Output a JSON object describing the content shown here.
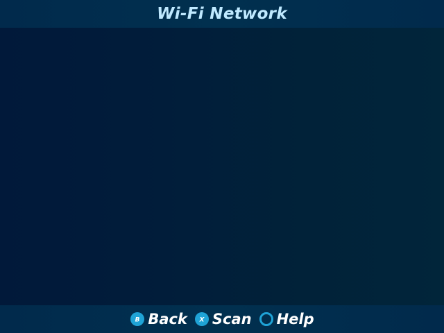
{
  "header": {
    "title": "Wi-Fi Network"
  },
  "footer": {
    "hints": [
      {
        "button": "B",
        "label": "Back",
        "icon": "b-button-icon"
      },
      {
        "button": "X",
        "label": "Scan",
        "icon": "x-button-icon"
      },
      {
        "button": "",
        "label": "Help",
        "icon": "circle-button-icon"
      }
    ]
  },
  "colors": {
    "accent": "#1fa3d6",
    "bar_background": "#012c4d",
    "body_background": "#011c3a",
    "title_text": "#bfe9ff",
    "hint_text": "#ffffff"
  }
}
